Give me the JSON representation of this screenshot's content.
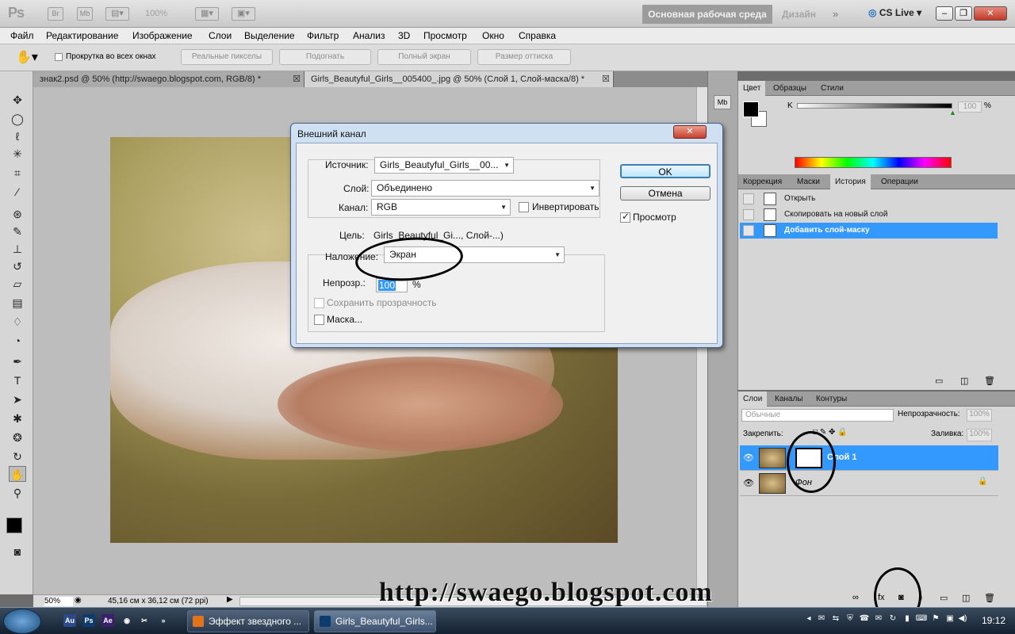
{
  "app": {
    "logo": "Ps",
    "icons": [
      "Br",
      "Mb"
    ],
    "zoom": "100%",
    "workspace": "Основная рабочая среда",
    "design": "Дизайн",
    "cs_live": "CS Live"
  },
  "menu": [
    "Файл",
    "Редактирование",
    "Изображение",
    "Слои",
    "Выделение",
    "Фильтр",
    "Анализ",
    "3D",
    "Просмотр",
    "Окно",
    "Справка"
  ],
  "options": {
    "scroll_all": "Прокрутка во всех окнах",
    "buttons": [
      "Реальные пикселы",
      "Подогнать",
      "Полный экран",
      "Размер оттиска"
    ]
  },
  "tabs": [
    {
      "label": "знак2.psd @ 50% (http://swaego.blogspot.com, RGB/8) *"
    },
    {
      "label": "Girls_Beautyful_Girls__005400_.jpg @ 50% (Слой 1, Слой-маска/8) *"
    }
  ],
  "status": {
    "zoom": "50%",
    "size": "45,16 см x 36,12 см (72 ppi)"
  },
  "color_panel": {
    "tabs": [
      "Цвет",
      "Образцы",
      "Стили"
    ],
    "channel_label": "K",
    "value": "100",
    "unit": "%",
    "slider_level": 1.0,
    "foreground": "#000000",
    "background": "#ffffff"
  },
  "history_panel": {
    "tabs": [
      "Коррекция",
      "Маски",
      "История",
      "Операции"
    ],
    "items": [
      "Открыть",
      "Скопировать на новый слой",
      "Добавить слой-маску"
    ],
    "selected": 2
  },
  "layers_panel": {
    "tabs": [
      "Слои",
      "Каналы",
      "Контуры"
    ],
    "blend_mode": "Обычные",
    "opacity_label": "Непрозрачность:",
    "opacity": "100%",
    "lock_label": "Закрепить:",
    "fill_label": "Заливка:",
    "fill": "100%",
    "layers": [
      {
        "name": "Слой 1",
        "selected": true
      },
      {
        "name": "Фон",
        "selected": false
      }
    ]
  },
  "dialog": {
    "title": "Внешний канал",
    "source_label": "Источник:",
    "source_value": "Girls_Beautyful_Girls__00...",
    "layer_label": "Слой:",
    "layer_value": "Объединено",
    "channel_label": "Канал:",
    "channel_value": "RGB",
    "invert_label": "Инвертировать",
    "target_label": "Цель:",
    "target_value": "Girls_Beautyful_Gi..., Слой-...)",
    "blending_label": "Наложение:",
    "blending_value": "Экран",
    "opacity_label": "Непрозр.:",
    "opacity_value": "100",
    "opacity_unit": "%",
    "preserve_label": "Сохранить прозрачность",
    "mask_label": "Маска...",
    "ok": "OK",
    "cancel": "Отмена",
    "preview_label": "Просмотр"
  },
  "watermark": "http://swaego.blogspot.com",
  "taskbar": {
    "apps": [
      "Au",
      "Ps",
      "Ae"
    ],
    "tasks": [
      "Эффект звездного ...",
      "Girls_Beautyful_Girls..."
    ],
    "clock": "19:12"
  }
}
